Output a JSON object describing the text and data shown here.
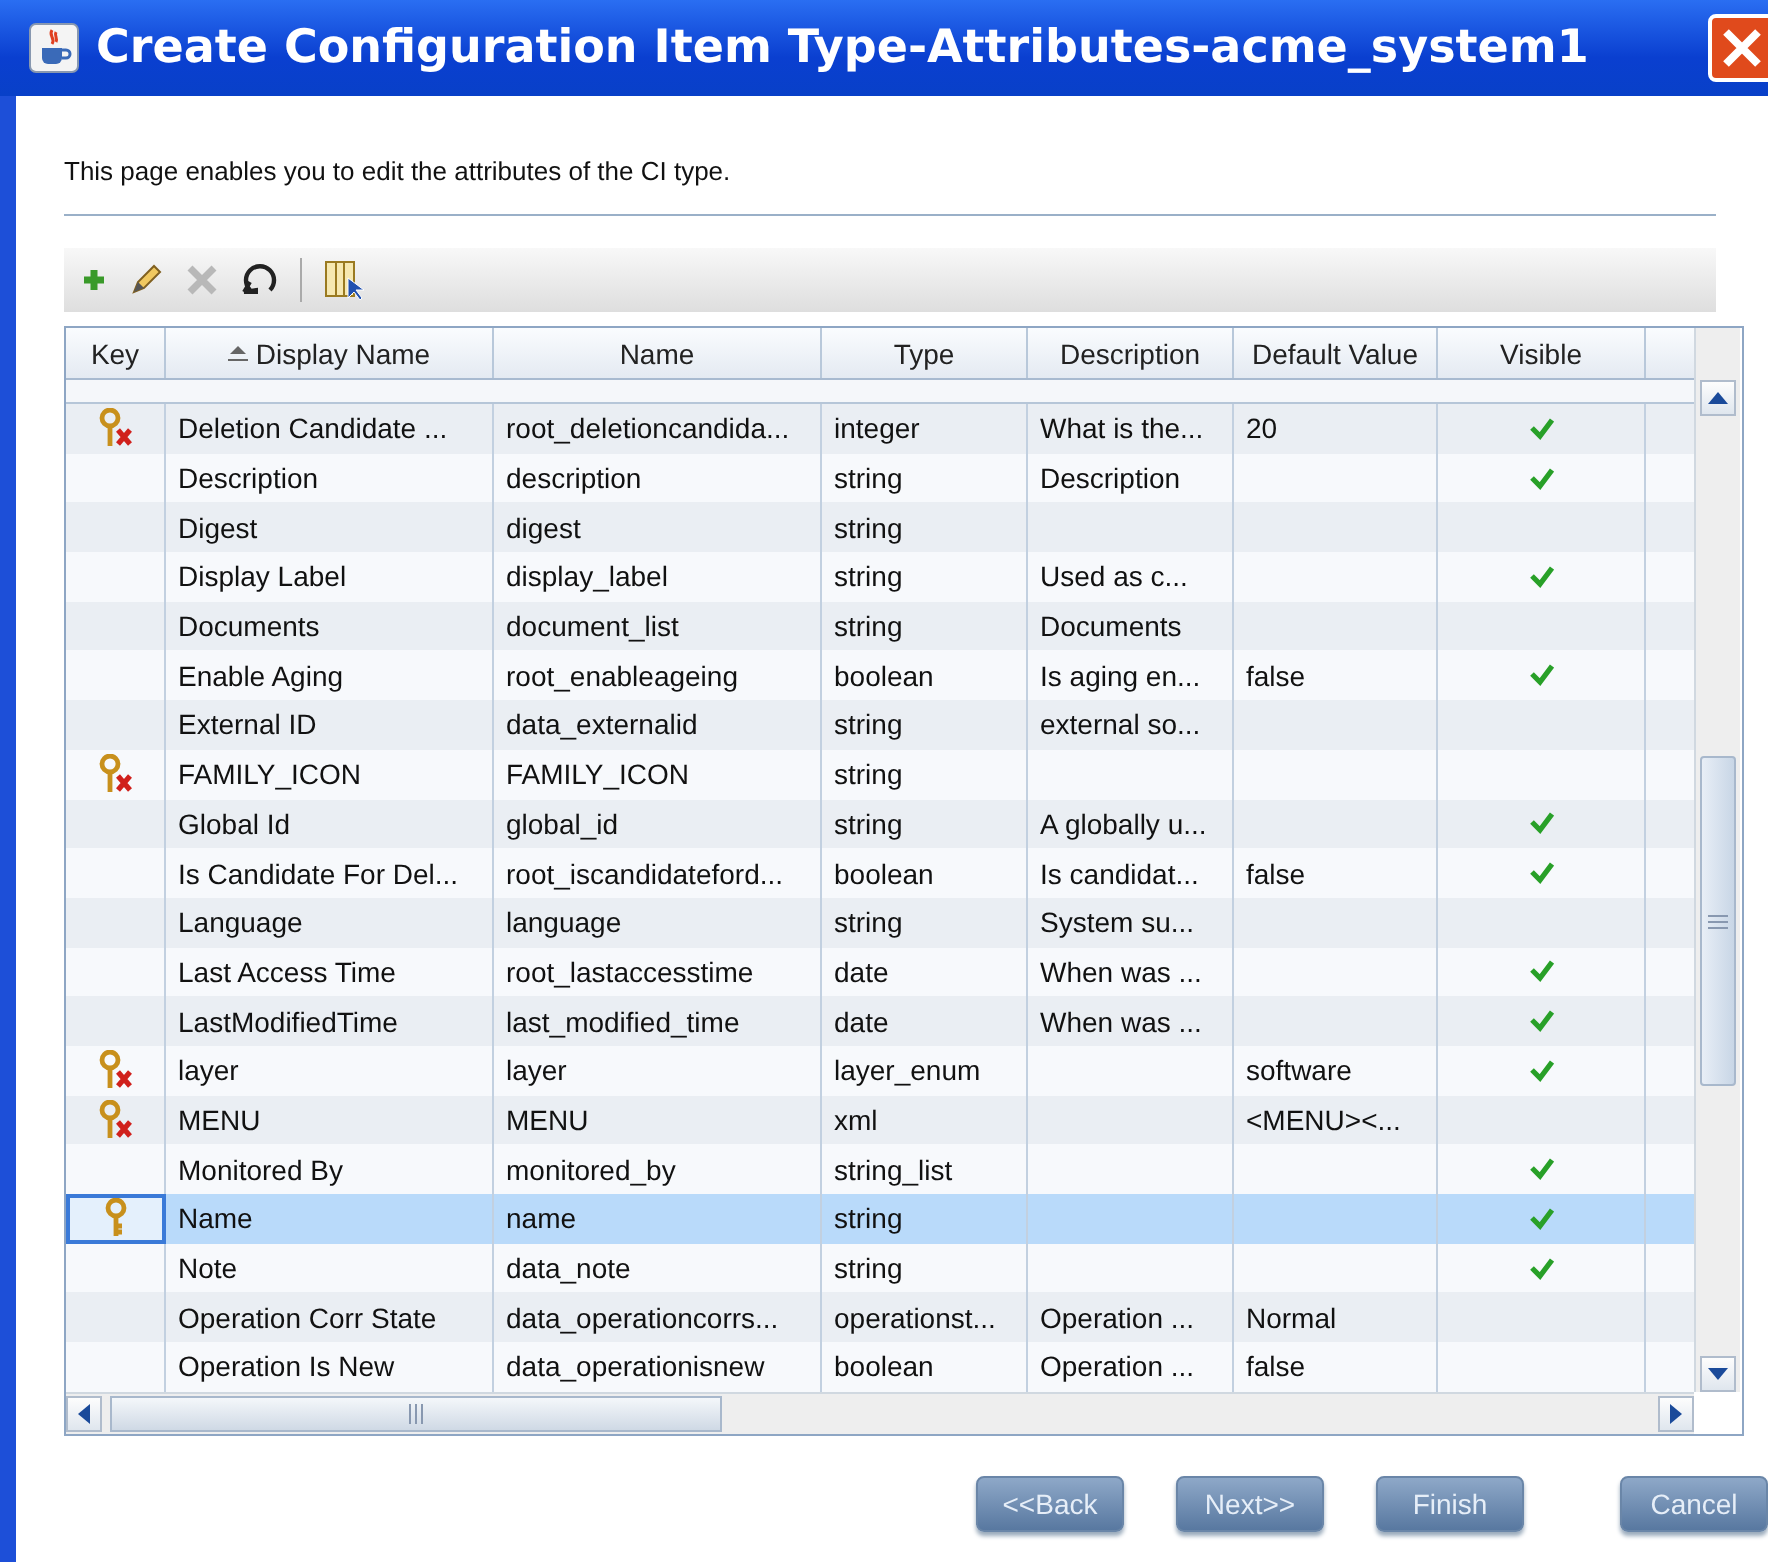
{
  "window": {
    "title": "Create Configuration Item Type-Attributes-acme_system1"
  },
  "description": "This page enables you to edit the attributes of the CI type.",
  "table": {
    "columns": [
      "Key",
      "Display Name",
      "Name",
      "Type",
      "Description",
      "Default Value",
      "Visible"
    ],
    "rows": [
      {
        "kind": "key-deleted",
        "display_name": "Deletion Candidate ...",
        "name": "root_deletioncandida...",
        "type": "integer",
        "description": "What is the...",
        "default_value": "20",
        "visible": true,
        "selected": false
      },
      {
        "kind": "none",
        "display_name": "Description",
        "name": "description",
        "type": "string",
        "description": "Description",
        "default_value": "",
        "visible": true,
        "selected": false
      },
      {
        "kind": "none",
        "display_name": "Digest",
        "name": "digest",
        "type": "string",
        "description": "",
        "default_value": "",
        "visible": false,
        "selected": false
      },
      {
        "kind": "none",
        "display_name": "Display Label",
        "name": "display_label",
        "type": "string",
        "description": "Used as c...",
        "default_value": "",
        "visible": true,
        "selected": false
      },
      {
        "kind": "none",
        "display_name": "Documents",
        "name": "document_list",
        "type": "string",
        "description": "Documents",
        "default_value": "",
        "visible": false,
        "selected": false
      },
      {
        "kind": "none",
        "display_name": "Enable Aging",
        "name": "root_enableageing",
        "type": "boolean",
        "description": "Is aging en...",
        "default_value": "false",
        "visible": true,
        "selected": false
      },
      {
        "kind": "none",
        "display_name": "External ID",
        "name": "data_externalid",
        "type": "string",
        "description": "external so...",
        "default_value": "",
        "visible": false,
        "selected": false
      },
      {
        "kind": "key-deleted",
        "display_name": "FAMILY_ICON",
        "name": "FAMILY_ICON",
        "type": "string",
        "description": "",
        "default_value": "",
        "visible": false,
        "selected": false
      },
      {
        "kind": "none",
        "display_name": "Global Id",
        "name": "global_id",
        "type": "string",
        "description": "A globally u...",
        "default_value": "",
        "visible": true,
        "selected": false
      },
      {
        "kind": "none",
        "display_name": "Is Candidate For Del...",
        "name": "root_iscandidateford...",
        "type": "boolean",
        "description": "Is candidat...",
        "default_value": "false",
        "visible": true,
        "selected": false
      },
      {
        "kind": "none",
        "display_name": "Language",
        "name": "language",
        "type": "string",
        "description": "System su...",
        "default_value": "",
        "visible": false,
        "selected": false
      },
      {
        "kind": "none",
        "display_name": "Last Access Time",
        "name": "root_lastaccesstime",
        "type": "date",
        "description": "When was ...",
        "default_value": "",
        "visible": true,
        "selected": false
      },
      {
        "kind": "none",
        "display_name": "LastModifiedTime",
        "name": "last_modified_time",
        "type": "date",
        "description": "When was ...",
        "default_value": "",
        "visible": true,
        "selected": false
      },
      {
        "kind": "key-deleted",
        "display_name": "layer",
        "name": "layer",
        "type": "layer_enum",
        "description": "",
        "default_value": "software",
        "visible": true,
        "selected": false
      },
      {
        "kind": "key-deleted",
        "display_name": "MENU",
        "name": "MENU",
        "type": "xml",
        "description": "",
        "default_value": "<MENU><...",
        "visible": false,
        "selected": false
      },
      {
        "kind": "none",
        "display_name": "Monitored By",
        "name": "monitored_by",
        "type": "string_list",
        "description": "",
        "default_value": "",
        "visible": true,
        "selected": false
      },
      {
        "kind": "key",
        "display_name": "Name",
        "name": "name",
        "type": "string",
        "description": "",
        "default_value": "",
        "visible": true,
        "selected": true
      },
      {
        "kind": "none",
        "display_name": "Note",
        "name": "data_note",
        "type": "string",
        "description": "",
        "default_value": "",
        "visible": true,
        "selected": false
      },
      {
        "kind": "none",
        "display_name": "Operation Corr State",
        "name": "data_operationcorrs...",
        "type": "operationst...",
        "description": "Operation ...",
        "default_value": "Normal",
        "visible": false,
        "selected": false
      },
      {
        "kind": "none",
        "display_name": "Operation Is New",
        "name": "data_operationisnew",
        "type": "boolean",
        "description": "Operation ...",
        "default_value": "false",
        "visible": false,
        "selected": false
      }
    ]
  },
  "buttons": [
    "<<Back",
    "Next>>",
    "Finish",
    "Cancel"
  ]
}
